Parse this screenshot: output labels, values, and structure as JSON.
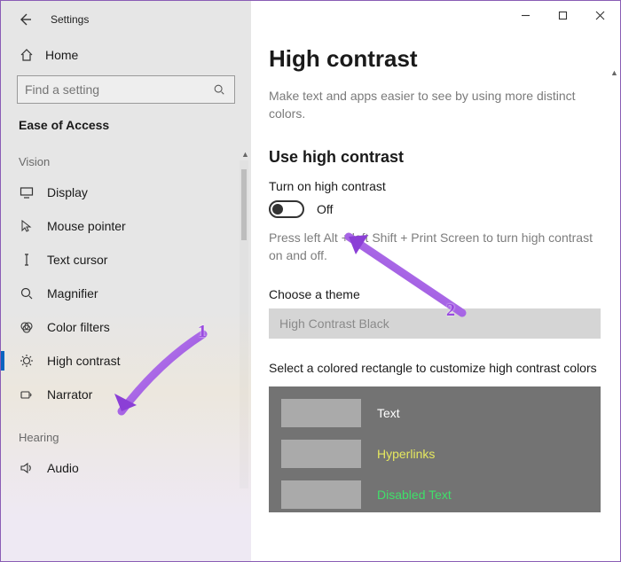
{
  "window": {
    "app_title": "Settings"
  },
  "sidebar": {
    "home_label": "Home",
    "search_placeholder": "Find a setting",
    "section": "Ease of Access",
    "group_vision": "Vision",
    "group_hearing": "Hearing",
    "items": [
      {
        "slug": "display",
        "label": "Display"
      },
      {
        "slug": "mouse-pointer",
        "label": "Mouse pointer"
      },
      {
        "slug": "text-cursor",
        "label": "Text cursor"
      },
      {
        "slug": "magnifier",
        "label": "Magnifier"
      },
      {
        "slug": "color-filters",
        "label": "Color filters"
      },
      {
        "slug": "high-contrast",
        "label": "High contrast"
      },
      {
        "slug": "narrator",
        "label": "Narrator"
      }
    ],
    "hearing_items": [
      {
        "slug": "audio",
        "label": "Audio"
      }
    ]
  },
  "content": {
    "title": "High contrast",
    "subtitle": "Make text and apps easier to see by using more distinct colors.",
    "section_use": "Use high contrast",
    "toggle_label": "Turn on high contrast",
    "toggle_state": "Off",
    "shortcut_hint": "Press left Alt + left Shift + Print Screen to turn high contrast on and off.",
    "choose_theme_label": "Choose a theme",
    "theme_value": "High Contrast Black",
    "customize_label": "Select a colored rectangle to customize high contrast colors",
    "swatches": [
      {
        "label": "Text",
        "class": "swatch-label-text"
      },
      {
        "label": "Hyperlinks",
        "class": "swatch-label-link"
      },
      {
        "label": "Disabled Text",
        "class": "swatch-label-disabled"
      }
    ]
  },
  "annotations": {
    "one": "1",
    "two": "2"
  }
}
